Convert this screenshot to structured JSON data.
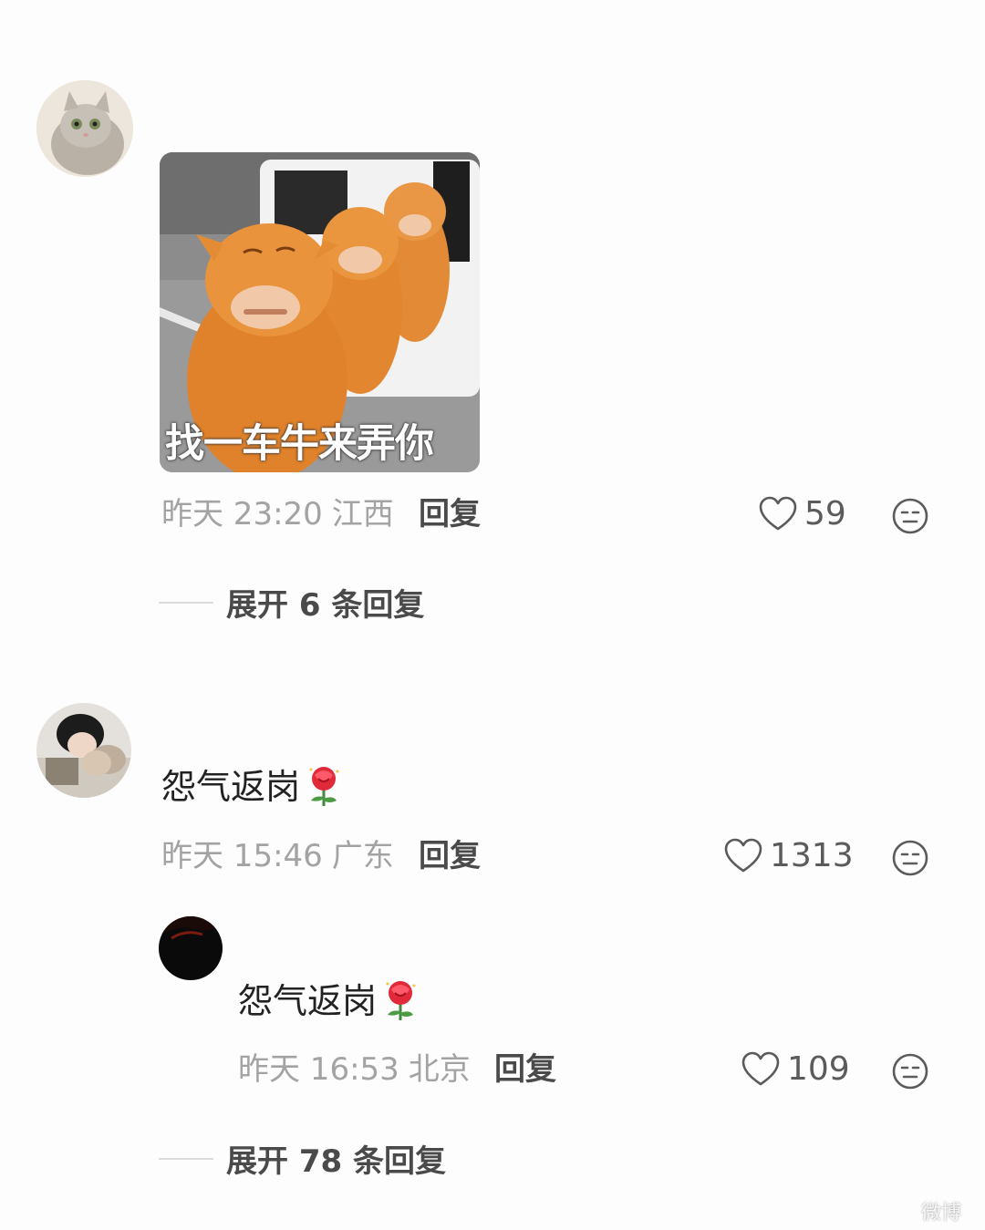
{
  "comments": [
    {
      "meme_caption": "找一车牛来弄你",
      "meta": {
        "time": "昨天 23:20",
        "location": "江西"
      },
      "reply_label": "回复",
      "likes": "59",
      "expand_label": "展开 6 条回复"
    },
    {
      "text": "怨气返岗",
      "meta": {
        "time": "昨天 15:46",
        "location": "广东"
      },
      "reply_label": "回复",
      "likes": "1313",
      "sub_reply": {
        "text": "怨气返岗",
        "meta": {
          "time": "昨天 16:53",
          "location": "北京"
        },
        "reply_label": "回复",
        "likes": "109"
      },
      "expand_label": "展开 78 条回复"
    }
  ],
  "icons": {
    "like": "heart-outline-icon",
    "dislike": "neutral-face-icon",
    "emoji": "rose-emoji-icon"
  },
  "colors": {
    "background": "#fdfdfd",
    "meta_text": "#a3a3a3",
    "action_text": "#4a4a4a",
    "body_text": "#222222",
    "meme_orange": "#e8913a"
  },
  "watermark": "微博"
}
